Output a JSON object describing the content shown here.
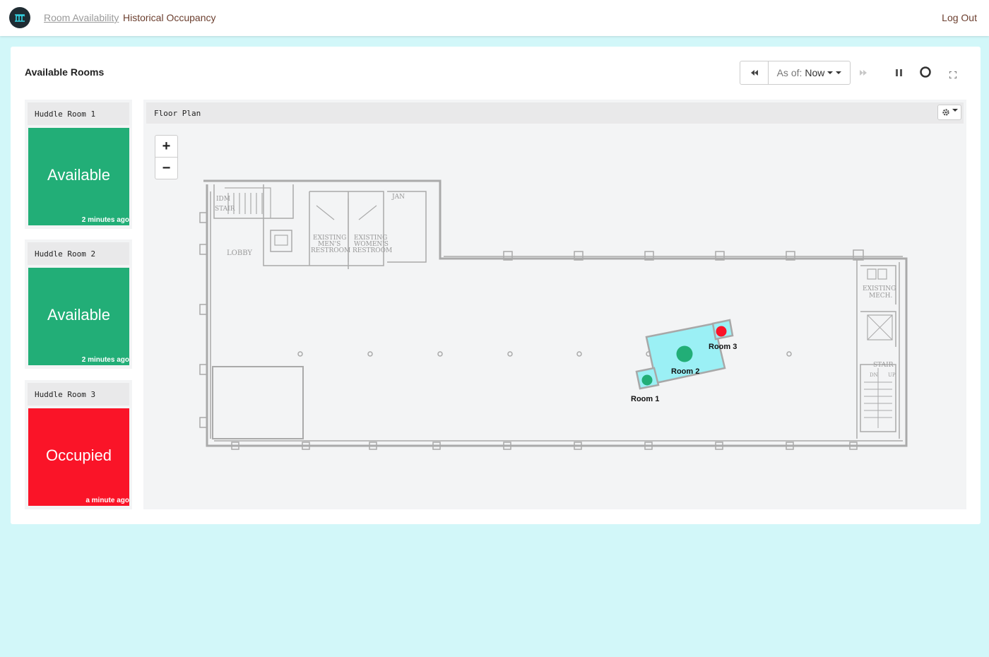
{
  "nav": {
    "links": [
      "Room Availability",
      "Historical Occupancy"
    ],
    "logout": "Log Out"
  },
  "card": {
    "title": "Available Rooms"
  },
  "toolbar": {
    "as_of_label": "As of:",
    "as_of_value": "Now"
  },
  "rooms": [
    {
      "name": "Huddle Room 1",
      "status": "Available",
      "ago": "2 minutes ago",
      "color": "#22ae77"
    },
    {
      "name": "Huddle Room 2",
      "status": "Available",
      "ago": "2 minutes ago",
      "color": "#22ae77"
    },
    {
      "name": "Huddle Room 3",
      "status": "Occupied",
      "ago": "a minute ago",
      "color": "#fa1428"
    }
  ],
  "floorplan": {
    "title": "Floor Plan",
    "zoom_in": "+",
    "zoom_out": "−",
    "labels": {
      "idm_stair": "IDM\nSTAIR",
      "jan": "JAN",
      "lobby": "LOBBY",
      "men": "EXISTING\nMEN'S\nRESTROOM",
      "women": "EXISTING\nWOMEN'S\nRESTROOM",
      "mech": "EXISTING\nMECH.",
      "stair": "STAIR",
      "dn": "DN",
      "up": "UP"
    },
    "room_markers": [
      {
        "label": "Room 1",
        "color": "#22ae77"
      },
      {
        "label": "Room 2",
        "color": "#22ae77"
      },
      {
        "label": "Room 3",
        "color": "#fa1428"
      }
    ],
    "room2_fill": "#9bf0f5"
  }
}
